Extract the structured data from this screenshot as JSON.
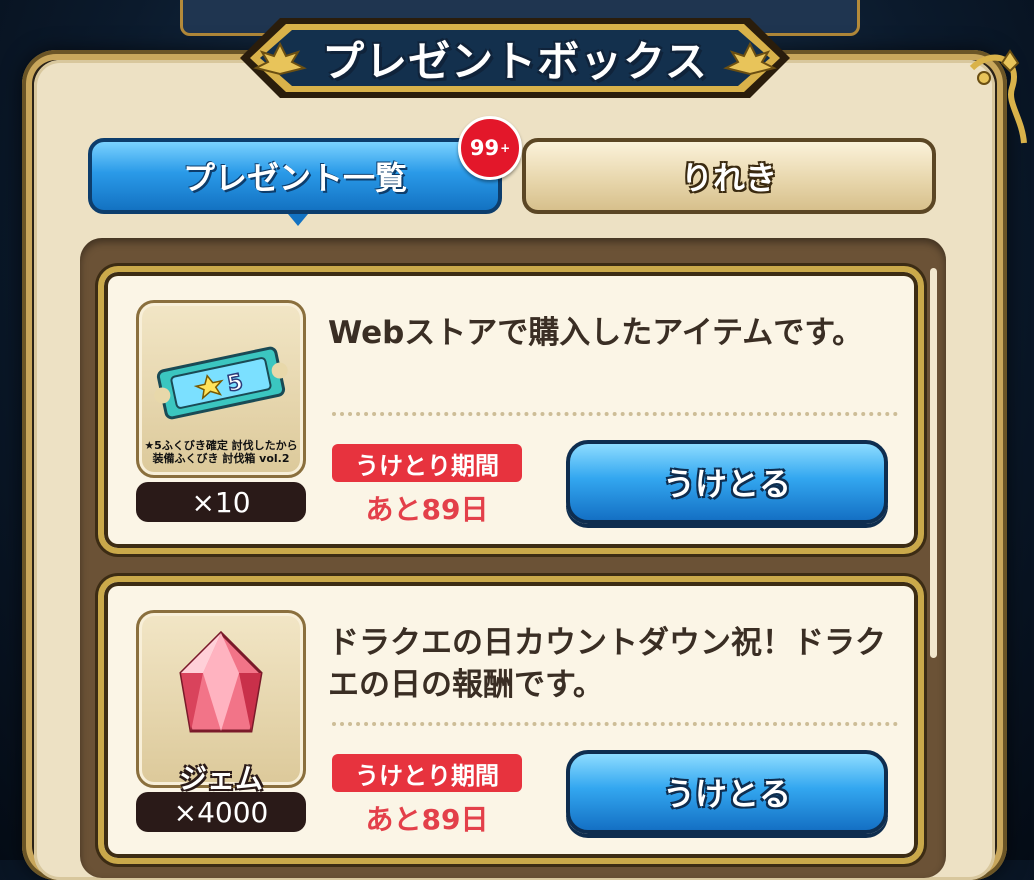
{
  "header": {
    "title": "プレゼントボックス"
  },
  "tabs": [
    {
      "label": "プレゼント一覧",
      "active": true,
      "badge": "99",
      "badge_suffix": "+"
    },
    {
      "label": "りれき",
      "active": false
    }
  ],
  "gifts": [
    {
      "icon": "ticket-icon",
      "item_caption": "★5ふくびき確定 討伐したから装備ふくびき 討伐箱 vol.2",
      "quantity": "×10",
      "description": "Webストアで購入したアイテムです。",
      "period_label": "うけとり期間",
      "period_remaining": "あと89日",
      "receive_label": "うけとる"
    },
    {
      "icon": "gem-icon",
      "item_name": "ジェム",
      "quantity": "×4000",
      "description": "ドラクエの日カウントダウン祝！ドラクエの日の報酬です。",
      "period_label": "うけとり期間",
      "period_remaining": "あと89日",
      "receive_label": "うけとる"
    }
  ],
  "colors": {
    "frame_gold": "#c9a75c",
    "panel_cream": "#ede1c4",
    "button_blue": "#2a9ae8",
    "badge_red": "#e3172a",
    "period_red": "#e7333e"
  }
}
